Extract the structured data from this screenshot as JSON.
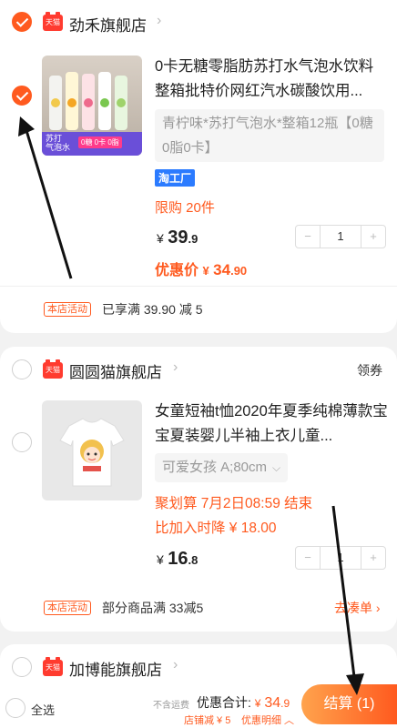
{
  "store1": {
    "name": "劲禾旗舰店",
    "tmall_badge": "天猫",
    "item": {
      "title": "0卡无糖零脂肪苏打水气泡水饮料整箱批特价网红汽水碳酸饮用...",
      "sku": "青柠味*苏打气泡水*整箱12瓶【0糖0脂0卡】",
      "tag": "淘工厂",
      "limit": "限购 20件",
      "price_symbol": "¥",
      "price_int": "39",
      "price_dec": ".9",
      "discount_label": "优惠价",
      "discount_symbol": "¥",
      "discount_int": "34",
      "discount_dec": ".90",
      "qty": "1",
      "thumb_text_1": "苏打",
      "thumb_text_2": "气泡水",
      "thumb_text_3": "0糖 0卡 0脂"
    },
    "promo_badge": "本店活动",
    "promo_text": "已享满 39.90 减 5"
  },
  "store2": {
    "name": "圆圆猫旗舰店",
    "tmall_badge": "天猫",
    "coupon": "领券",
    "item": {
      "title": "女童短袖t恤2020年夏季纯棉薄款宝宝夏装婴儿半袖上衣儿童...",
      "sku": "可爱女孩 A;80cm",
      "event": "聚划算 7月2日08:59 结束",
      "compare": "比加入时降 ¥ 18.00",
      "price_symbol": "¥",
      "price_int": "16",
      "price_dec": ".8",
      "qty": "1"
    },
    "promo_badge": "本店活动",
    "promo_text": "部分商品满 33减5",
    "add_more": "去凑单"
  },
  "store3": {
    "name": "加博能旗舰店",
    "tmall_badge": "天猫"
  },
  "bottom": {
    "select_all": "全选",
    "no_shipping": "不含运费",
    "total_label": "优惠合计:",
    "total_symbol": "¥",
    "total_int": "34",
    "total_dec": ".9",
    "reduce": "店铺减 ¥ 5",
    "detail": "优惠明细",
    "checkout": "结算 (1)"
  },
  "colors": {
    "accent": "#ff5a1f",
    "tmall": "#ff3b2f",
    "tag_blue": "#2b7bff"
  }
}
